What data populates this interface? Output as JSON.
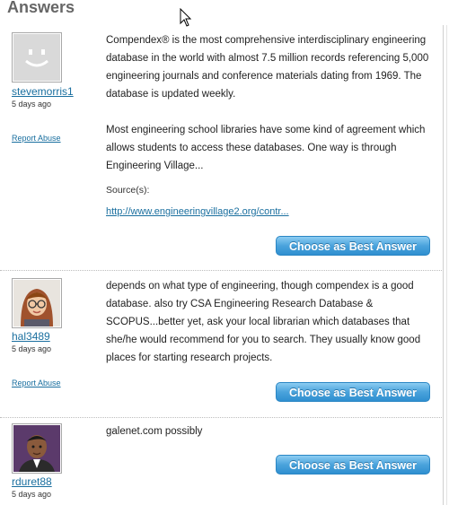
{
  "section": {
    "title": "Answers"
  },
  "answers": [
    {
      "username": "stevemorris1",
      "time": "5 days ago",
      "report": "Report Abuse",
      "paragraphs": [
        "Compendex® is the most comprehensive interdisciplinary engineering database in the world with almost 7.5 million records referencing 5,000 engineering journals and conference materials dating from 1969. The database is updated weekly.",
        "Most engineering school libraries have some kind of agreement which allows students to access these databases. One way is through Engineering Village..."
      ],
      "source_label": "Source(s):",
      "source_link": "http://www.engineeringvillage2.org/contr...",
      "button": "Choose as Best Answer",
      "avatar": "default-smiley-avatar"
    },
    {
      "username": "hal3489",
      "time": "5 days ago",
      "report": "Report Abuse",
      "paragraphs": [
        "depends on what type of engineering, though compendex is a good database. also try CSA Engineering Research Database & SCOPUS...better yet, ask your local librarian which databases that she/he would recommend for you to search. They usually know good places for starting research projects."
      ],
      "button": "Choose as Best Answer",
      "avatar": "woman-glasses-avatar"
    },
    {
      "username": "rduret88",
      "time": "5 days ago",
      "paragraphs": [
        "galenet.com possibly"
      ],
      "button": "Choose as Best Answer",
      "avatar": "man-suit-avatar"
    }
  ]
}
